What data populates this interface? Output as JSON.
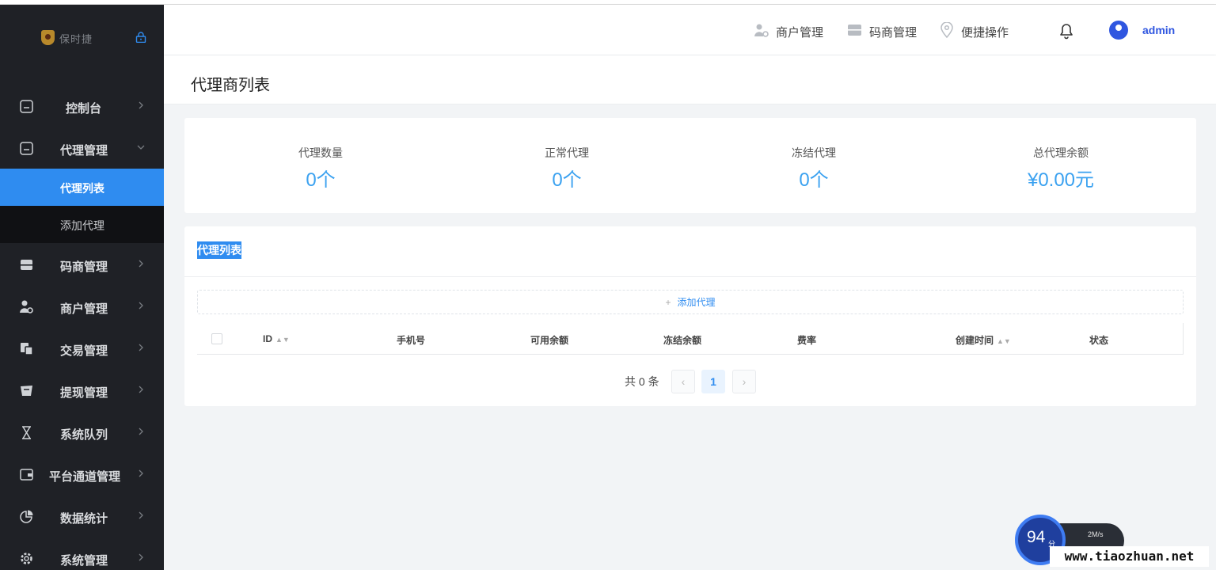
{
  "brand": {
    "logo_text": "保时捷"
  },
  "sidebar": {
    "items": [
      {
        "label": "控制台"
      },
      {
        "label": "代理管理"
      },
      {
        "label": "码商管理"
      },
      {
        "label": "商户管理"
      },
      {
        "label": "交易管理"
      },
      {
        "label": "提现管理"
      },
      {
        "label": "系统队列"
      },
      {
        "label": "平台通道管理"
      },
      {
        "label": "数据统计"
      },
      {
        "label": "系统管理"
      }
    ],
    "sub_items": [
      {
        "label": "代理列表",
        "active": true
      },
      {
        "label": "添加代理"
      }
    ]
  },
  "header": {
    "nav": [
      {
        "label": "商户管理",
        "icon": "user-gear-icon"
      },
      {
        "label": "码商管理",
        "icon": "store-icon"
      },
      {
        "label": "便捷操作",
        "icon": "location-pin-icon"
      }
    ],
    "user": "admin"
  },
  "page": {
    "title": "代理商列表"
  },
  "stats": [
    {
      "label": "代理数量",
      "value": "0个"
    },
    {
      "label": "正常代理",
      "value": "0个"
    },
    {
      "label": "冻结代理",
      "value": "0个"
    },
    {
      "label": "总代理余额",
      "value": "¥0.00元"
    }
  ],
  "list": {
    "title": "代理列表",
    "add_button": "添加代理",
    "columns": [
      "ID",
      "手机号",
      "可用余额",
      "冻结余额",
      "费率",
      "创建时间",
      "状态"
    ],
    "rows": [],
    "pagination": {
      "total_text": "共 0 条",
      "current_page": "1"
    }
  },
  "overlay": {
    "score": "94",
    "score_unit": "分",
    "speed": "2M/s",
    "watermark": "www.tiaozhuan.net"
  },
  "colors": {
    "accent": "#2f8cf0",
    "sidebar_bg": "#1f2126",
    "stat_value": "#3aa1f0"
  }
}
